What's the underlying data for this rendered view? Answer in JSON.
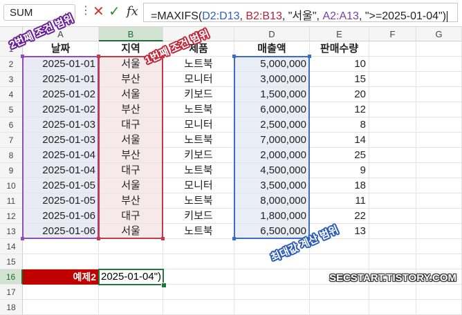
{
  "name_box": {
    "value": "SUM"
  },
  "formula_bar": {
    "prefix": "=MAXIFS(",
    "ref1": "D2:D13",
    "sep1": ", ",
    "ref2": "B2:B13",
    "mid": ", \"서울\", ",
    "ref3": "A2:A13",
    "suffix": ", \">=2025-01-04\")"
  },
  "icons": {
    "cancel": "close-icon",
    "confirm": "check-icon",
    "function": "fx-icon"
  },
  "columns": [
    "A",
    "B",
    "C",
    "D",
    "E",
    "F",
    "G"
  ],
  "rows": [
    "1",
    "2",
    "3",
    "4",
    "5",
    "6",
    "7",
    "8",
    "9",
    "10",
    "11",
    "12",
    "13",
    "14",
    "15",
    "16",
    "17",
    "18"
  ],
  "table": {
    "headers": [
      "날짜",
      "지역",
      "제품",
      "매출액",
      "판매수량"
    ],
    "data": [
      [
        "2025-01-01",
        "서울",
        "노트북",
        "5,000,000",
        "10"
      ],
      [
        "2025-01-01",
        "부산",
        "모니터",
        "3,000,000",
        "15"
      ],
      [
        "2025-01-02",
        "서울",
        "키보드",
        "1,500,000",
        "20"
      ],
      [
        "2025-01-02",
        "부산",
        "노트북",
        "6,000,000",
        "12"
      ],
      [
        "2025-01-03",
        "대구",
        "모니터",
        "2,500,000",
        "8"
      ],
      [
        "2025-01-03",
        "서울",
        "노트북",
        "7,000,000",
        "14"
      ],
      [
        "2025-01-04",
        "부산",
        "키보드",
        "2,000,000",
        "25"
      ],
      [
        "2025-01-04",
        "대구",
        "노트북",
        "4,500,000",
        "9"
      ],
      [
        "2025-01-05",
        "서울",
        "모니터",
        "3,500,000",
        "18"
      ],
      [
        "2025-01-05",
        "부산",
        "노트북",
        "8,000,000",
        "11"
      ],
      [
        "2025-01-06",
        "대구",
        "키보드",
        "1,800,000",
        "22"
      ],
      [
        "2025-01-06",
        "서울",
        "노트북",
        "6,500,000",
        "13"
      ]
    ]
  },
  "example": {
    "label": "예제2",
    "active_cell_text": "2025-01-04\")"
  },
  "annotations": {
    "criteria2": "2번째 조건 범위",
    "criteria1": "1번째 조건 범위",
    "max_range": "최대값 계산 범위"
  },
  "watermark": "SECSTART.TISTORY.COM",
  "colors": {
    "criteria2_range": "#8a4fb8",
    "criteria1_range": "#c23a4a",
    "max_range": "#3b6ec2",
    "example_label_bg": "#c00000",
    "active_cell_border": "#1d7a3a"
  }
}
